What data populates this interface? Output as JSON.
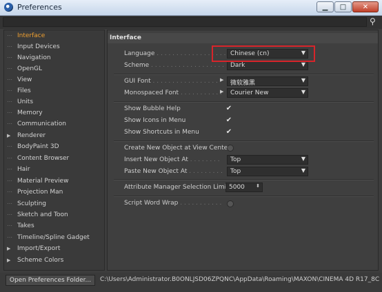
{
  "window": {
    "title": "Preferences"
  },
  "sidebar": {
    "items": [
      {
        "label": "Interface",
        "active": true,
        "expandable": false
      },
      {
        "label": "Input Devices",
        "expandable": false
      },
      {
        "label": "Navigation",
        "expandable": false
      },
      {
        "label": "OpenGL",
        "expandable": false
      },
      {
        "label": "View",
        "expandable": false
      },
      {
        "label": "Files",
        "expandable": false
      },
      {
        "label": "Units",
        "expandable": false
      },
      {
        "label": "Memory",
        "expandable": false
      },
      {
        "label": "Communication",
        "expandable": false
      },
      {
        "label": "Renderer",
        "expandable": true
      },
      {
        "label": "BodyPaint 3D",
        "expandable": false
      },
      {
        "label": "Content Browser",
        "expandable": false
      },
      {
        "label": "Hair",
        "expandable": false
      },
      {
        "label": "Material Preview",
        "expandable": false
      },
      {
        "label": "Projection Man",
        "expandable": false
      },
      {
        "label": "Sculpting",
        "expandable": false
      },
      {
        "label": "Sketch and Toon",
        "expandable": false
      },
      {
        "label": "Takes",
        "expandable": false
      },
      {
        "label": "Timeline/Spline Gadget",
        "expandable": false
      },
      {
        "label": "Import/Export",
        "expandable": true
      },
      {
        "label": "Scheme Colors",
        "expandable": true
      }
    ]
  },
  "main": {
    "section_title": "Interface",
    "language": {
      "label": "Language",
      "value": "Chinese (cn)"
    },
    "scheme": {
      "label": "Scheme",
      "value": "Dark"
    },
    "gui_font": {
      "label": "GUI Font",
      "value": "微软雅黑"
    },
    "mono_font": {
      "label": "Monospaced Font",
      "value": "Courier New"
    },
    "show_bubble_help": {
      "label": "Show Bubble Help",
      "checked": true
    },
    "show_icons_in_menu": {
      "label": "Show Icons in Menu",
      "checked": true
    },
    "show_shortcuts_in_menu": {
      "label": "Show Shortcuts in Menu",
      "checked": true
    },
    "create_new_object": {
      "label": "Create New Object at View Center",
      "checked": false
    },
    "insert_new_object": {
      "label": "Insert New Object At",
      "value": "Top"
    },
    "paste_new_object": {
      "label": "Paste New Object At",
      "value": "Top"
    },
    "attr_manager_limit": {
      "label": "Attribute Manager Selection Limit",
      "value": "5000"
    },
    "script_word_wrap": {
      "label": "Script Word Wrap",
      "checked": false
    }
  },
  "footer": {
    "open_folder_label": "Open Preferences Folder...",
    "path": "C:\\Users\\Administrator.B0ONLJSD06ZPQNC\\AppData\\Roaming\\MAXON\\CINEMA 4D R17_8C"
  },
  "colors": {
    "accent_active": "#f0a030",
    "highlight_box": "#d8242a"
  }
}
